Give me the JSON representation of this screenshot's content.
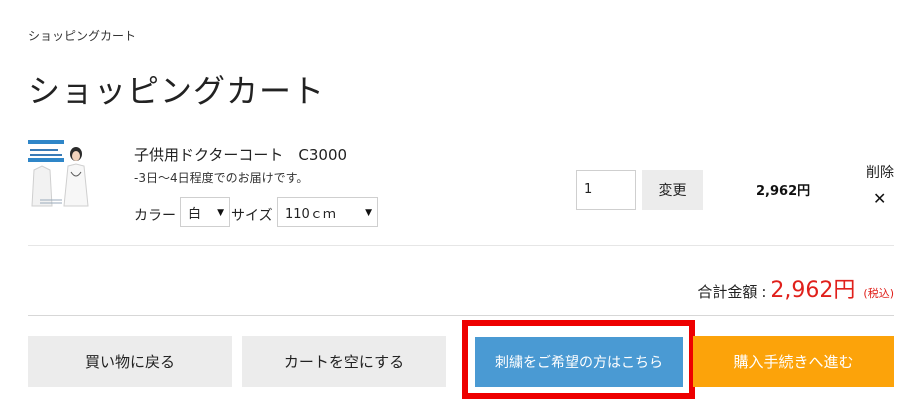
{
  "breadcrumb": "ショッピングカート",
  "page_title": "ショッピングカート",
  "cart_item": {
    "name": "子供用ドクターコート　C3000",
    "delivery_note": "-3日〜4日程度でのお届けです。",
    "color_label": "カラー",
    "color_value": "白",
    "size_label": "サイズ",
    "size_value": "110ｃｍ",
    "quantity": "1",
    "change_label": "変更",
    "price": "2,962円",
    "delete_label": "削除",
    "delete_icon": "close-icon",
    "thumbnail_text": "子供用\nドクターコート"
  },
  "total": {
    "label": "合計金額",
    "colon": ":",
    "value": "2,962円",
    "tax_note": "(税込)"
  },
  "buttons": {
    "back": "買い物に戻る",
    "clear": "カートを空にする",
    "embroidery": "刺繍をご希望の方はこちら",
    "checkout": "購入手続きへ進む"
  },
  "colors": {
    "price_red": "#e0201b",
    "embroidery_blue": "#4a9ad3",
    "checkout_orange": "#fca30a",
    "highlight_red": "#ee0000",
    "button_gray": "#ececec"
  }
}
